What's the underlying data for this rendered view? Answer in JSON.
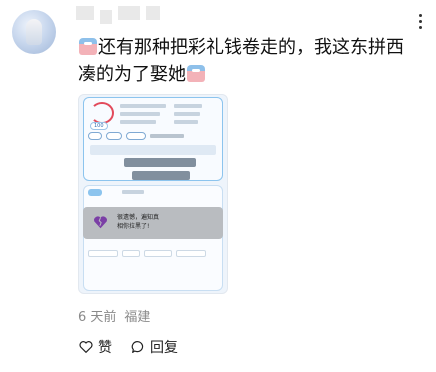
{
  "comment": {
    "text_part1": "还有那种把彩礼钱卷走的，我这东拼西凑的为了娶她",
    "posted_time": "6 天前",
    "location": "福建"
  },
  "actions": {
    "like_label": "赞",
    "reply_label": "回复"
  },
  "screenshot": {
    "score": "100",
    "modal_line1": "很遗憾，遍知真",
    "modal_line2": "相你拉黑了!"
  },
  "icons": {
    "emoji": "pink-blue-emoji-icon",
    "more": "more-dots-icon",
    "like": "heart-icon",
    "reply": "speech-bubble-icon",
    "broken_heart": "broken-heart-icon"
  },
  "colors": {
    "text": "#111111",
    "meta": "#8a8a8a",
    "screenshot_border": "#8cc4ee",
    "heart": "#e24a5b",
    "broken_heart": "#7b3fa6"
  }
}
